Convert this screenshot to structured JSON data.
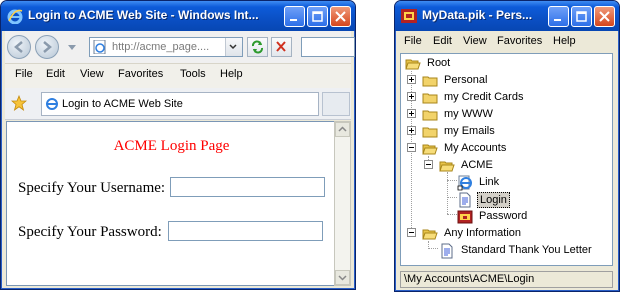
{
  "ie": {
    "title": "Login to ACME Web Site - Windows Int...",
    "address": "http://acme_page....",
    "menu": [
      "File",
      "Edit",
      "View",
      "Favorites",
      "Tools",
      "Help"
    ],
    "tab_label": "Login to ACME Web Site",
    "page": {
      "heading": "ACME Login Page",
      "username_label": "Specify Your Username:",
      "password_label": "Specify Your Password:"
    }
  },
  "pik": {
    "title": "MyData.pik - Pers...",
    "menu": [
      "File",
      "Edit",
      "View",
      "Favorites",
      "Help"
    ],
    "tree": [
      {
        "label": "Root",
        "icon": "folder-open-icon"
      },
      {
        "label": "Personal",
        "icon": "folder-icon"
      },
      {
        "label": "my Credit Cards",
        "icon": "folder-icon"
      },
      {
        "label": "my WWW",
        "icon": "folder-icon"
      },
      {
        "label": "my Emails",
        "icon": "folder-icon"
      },
      {
        "label": "My Accounts",
        "icon": "folder-open-icon"
      },
      {
        "label": "ACME",
        "icon": "folder-open-icon"
      },
      {
        "label": "Link",
        "icon": "ie-link-icon"
      },
      {
        "label": "Login",
        "icon": "document-icon",
        "selected": true
      },
      {
        "label": "Password",
        "icon": "password-icon"
      },
      {
        "label": "Any Information",
        "icon": "folder-open-icon"
      },
      {
        "label": "Standard Thank You Letter",
        "icon": "document-icon"
      }
    ],
    "status": "\\My Accounts\\ACME\\Login"
  },
  "colors": {
    "titlebar": "#0a4ec2",
    "heading_red": "#ff0000",
    "chrome": "#ece9d8"
  }
}
